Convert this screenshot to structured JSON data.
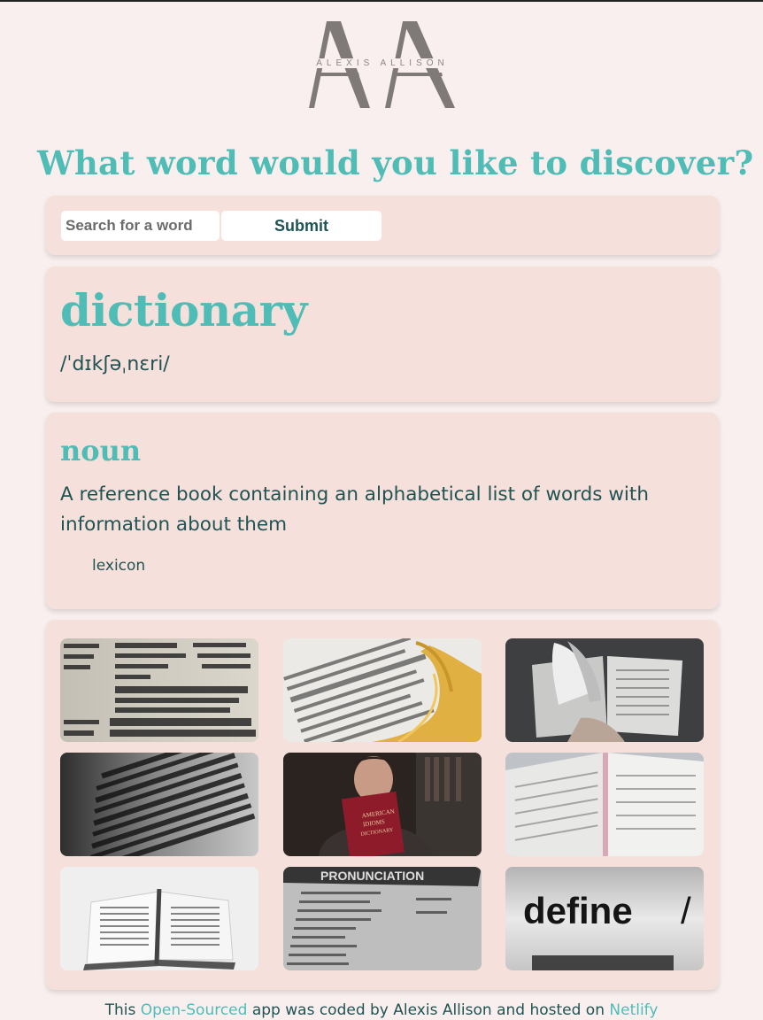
{
  "logo": {
    "monogram": "AA",
    "text": "ALEXIS ALLISON"
  },
  "headline": "What word would you like to discover?",
  "search": {
    "placeholder": "Search for a word",
    "submit_label": "Submit"
  },
  "result": {
    "word": "dictionary",
    "phonetic": "/ˈdɪkʃəˌnɛri/",
    "meaning": {
      "part_of_speech": "noun",
      "definition": "A reference book containing an alphabetical list of words with information about them",
      "synonym": "lexicon"
    }
  },
  "images": [
    {
      "alt": "close-up of dictionary entry for diction and dictionary"
    },
    {
      "alt": "dictionary page with golden tassel"
    },
    {
      "alt": "hands flipping open dictionary"
    },
    {
      "alt": "dark dictionary page close-up"
    },
    {
      "alt": "man holding American Idioms Dictionary"
    },
    {
      "alt": "open dictionary pages"
    },
    {
      "alt": "open book with pen"
    },
    {
      "alt": "pronunciation page"
    },
    {
      "alt": "define word close-up"
    }
  ],
  "image_texts": {
    "idioms_book": "AMERICAN IDIOMS DICTIONARY",
    "pronunciation": "PRONUNCIATION",
    "define": "define"
  },
  "footer": {
    "prefix": "This ",
    "open_source_link": "Open-Sourced",
    "middle": " app was coded by Alexis Allison and hosted on ",
    "netlify_link": "Netlify"
  },
  "colors": {
    "background": "#f9efee",
    "card": "#f5e0db",
    "accent": "#4fbdb6",
    "text_dark": "#205353"
  }
}
